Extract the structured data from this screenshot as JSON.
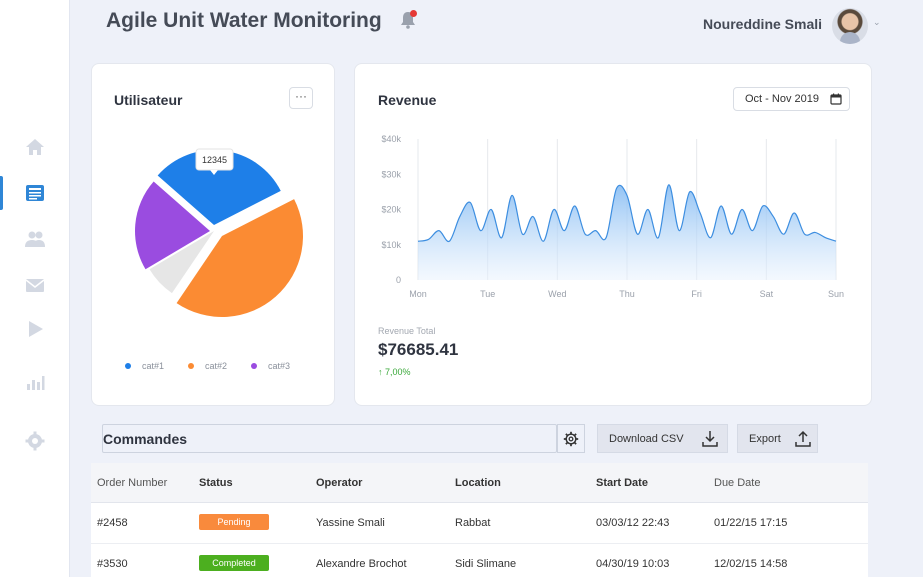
{
  "header": {
    "title": "Agile Unit Water Monitoring",
    "user_name": "Noureddine Smali"
  },
  "sidebar": {
    "items": [
      {
        "icon": "home-icon"
      },
      {
        "icon": "news-icon",
        "active": true
      },
      {
        "icon": "users-icon"
      },
      {
        "icon": "mail-icon"
      },
      {
        "icon": "play-icon"
      },
      {
        "icon": "chart-icon"
      },
      {
        "icon": "settings-icon"
      }
    ]
  },
  "user_card": {
    "title": "Utilisateur",
    "more_label": "···",
    "tooltip": "12345",
    "legend": [
      {
        "label": "cat#1",
        "color": "#1e7fe8"
      },
      {
        "label": "cat#2",
        "color": "#fb8b33"
      },
      {
        "label": "cat#3",
        "color": "#9a4ce0"
      }
    ]
  },
  "revenue_card": {
    "title": "Revenue",
    "date_range": "Oct - Nov 2019",
    "total_label": "Revenue Total",
    "total": "$76685.41",
    "change": "↑ 7,00%"
  },
  "chart_data": [
    {
      "type": "pie",
      "title": "",
      "slices": [
        {
          "name": "cat#1",
          "value": 31,
          "color": "#1e7fe8"
        },
        {
          "name": "cat#2",
          "value": 42,
          "color": "#fb8b33"
        },
        {
          "name": "",
          "value": 7,
          "color": "#e6e6e6"
        },
        {
          "name": "cat#3",
          "value": 20,
          "color": "#9a4ce0"
        }
      ],
      "tooltip_value": 12345
    },
    {
      "type": "area",
      "title": "Revenue",
      "categories": [
        "Mon",
        "Tue",
        "Wed",
        "Thu",
        "Fri",
        "Sat",
        "Sun"
      ],
      "y_ticks": [
        "0",
        "$10k",
        "$20k",
        "$30k",
        "$40k"
      ],
      "ylim": [
        0,
        40000
      ],
      "x": [
        0,
        0.15,
        0.3,
        0.45,
        0.6,
        0.75,
        0.9,
        1.05,
        1.2,
        1.35,
        1.5,
        1.65,
        1.8,
        1.95,
        2.1,
        2.25,
        2.4,
        2.55,
        2.7,
        2.85,
        3.0,
        3.15,
        3.3,
        3.45,
        3.6,
        3.75,
        3.9,
        4.05,
        4.2,
        4.35,
        4.5,
        4.65,
        4.8,
        4.95,
        5.1,
        5.25,
        5.4,
        5.55,
        5.7,
        5.85,
        6.0
      ],
      "values": [
        11000,
        11500,
        14000,
        11000,
        18000,
        22000,
        14000,
        20000,
        12000,
        24000,
        13000,
        18000,
        11000,
        20000,
        14000,
        21000,
        13000,
        14000,
        12000,
        26000,
        24000,
        13000,
        20000,
        12000,
        27000,
        14000,
        25000,
        19000,
        12000,
        21000,
        13000,
        20000,
        14000,
        21000,
        18000,
        13000,
        19000,
        13000,
        13500,
        12000,
        11000
      ]
    }
  ],
  "commandes": {
    "title": "Commandes",
    "download_label": "Download CSV",
    "export_label": "Export"
  },
  "table": {
    "headers": [
      "Order Number",
      "Status",
      "Operator",
      "Location",
      "Start Date",
      "Due Date"
    ],
    "rows": [
      {
        "order": "#2458",
        "status": "Pending",
        "status_color": "#f98a3c",
        "operator": "Yassine Smali",
        "location": "Rabbat",
        "start": "03/03/12 22:43",
        "due": "01/22/15 17:15"
      },
      {
        "order": "#3530",
        "status": "Completed",
        "status_color": "#4caf1f",
        "operator": "Alexandre Brochot",
        "location": "Sidi Slimane",
        "start": "04/30/19 10:03",
        "due": "12/02/15 14:58"
      }
    ]
  }
}
